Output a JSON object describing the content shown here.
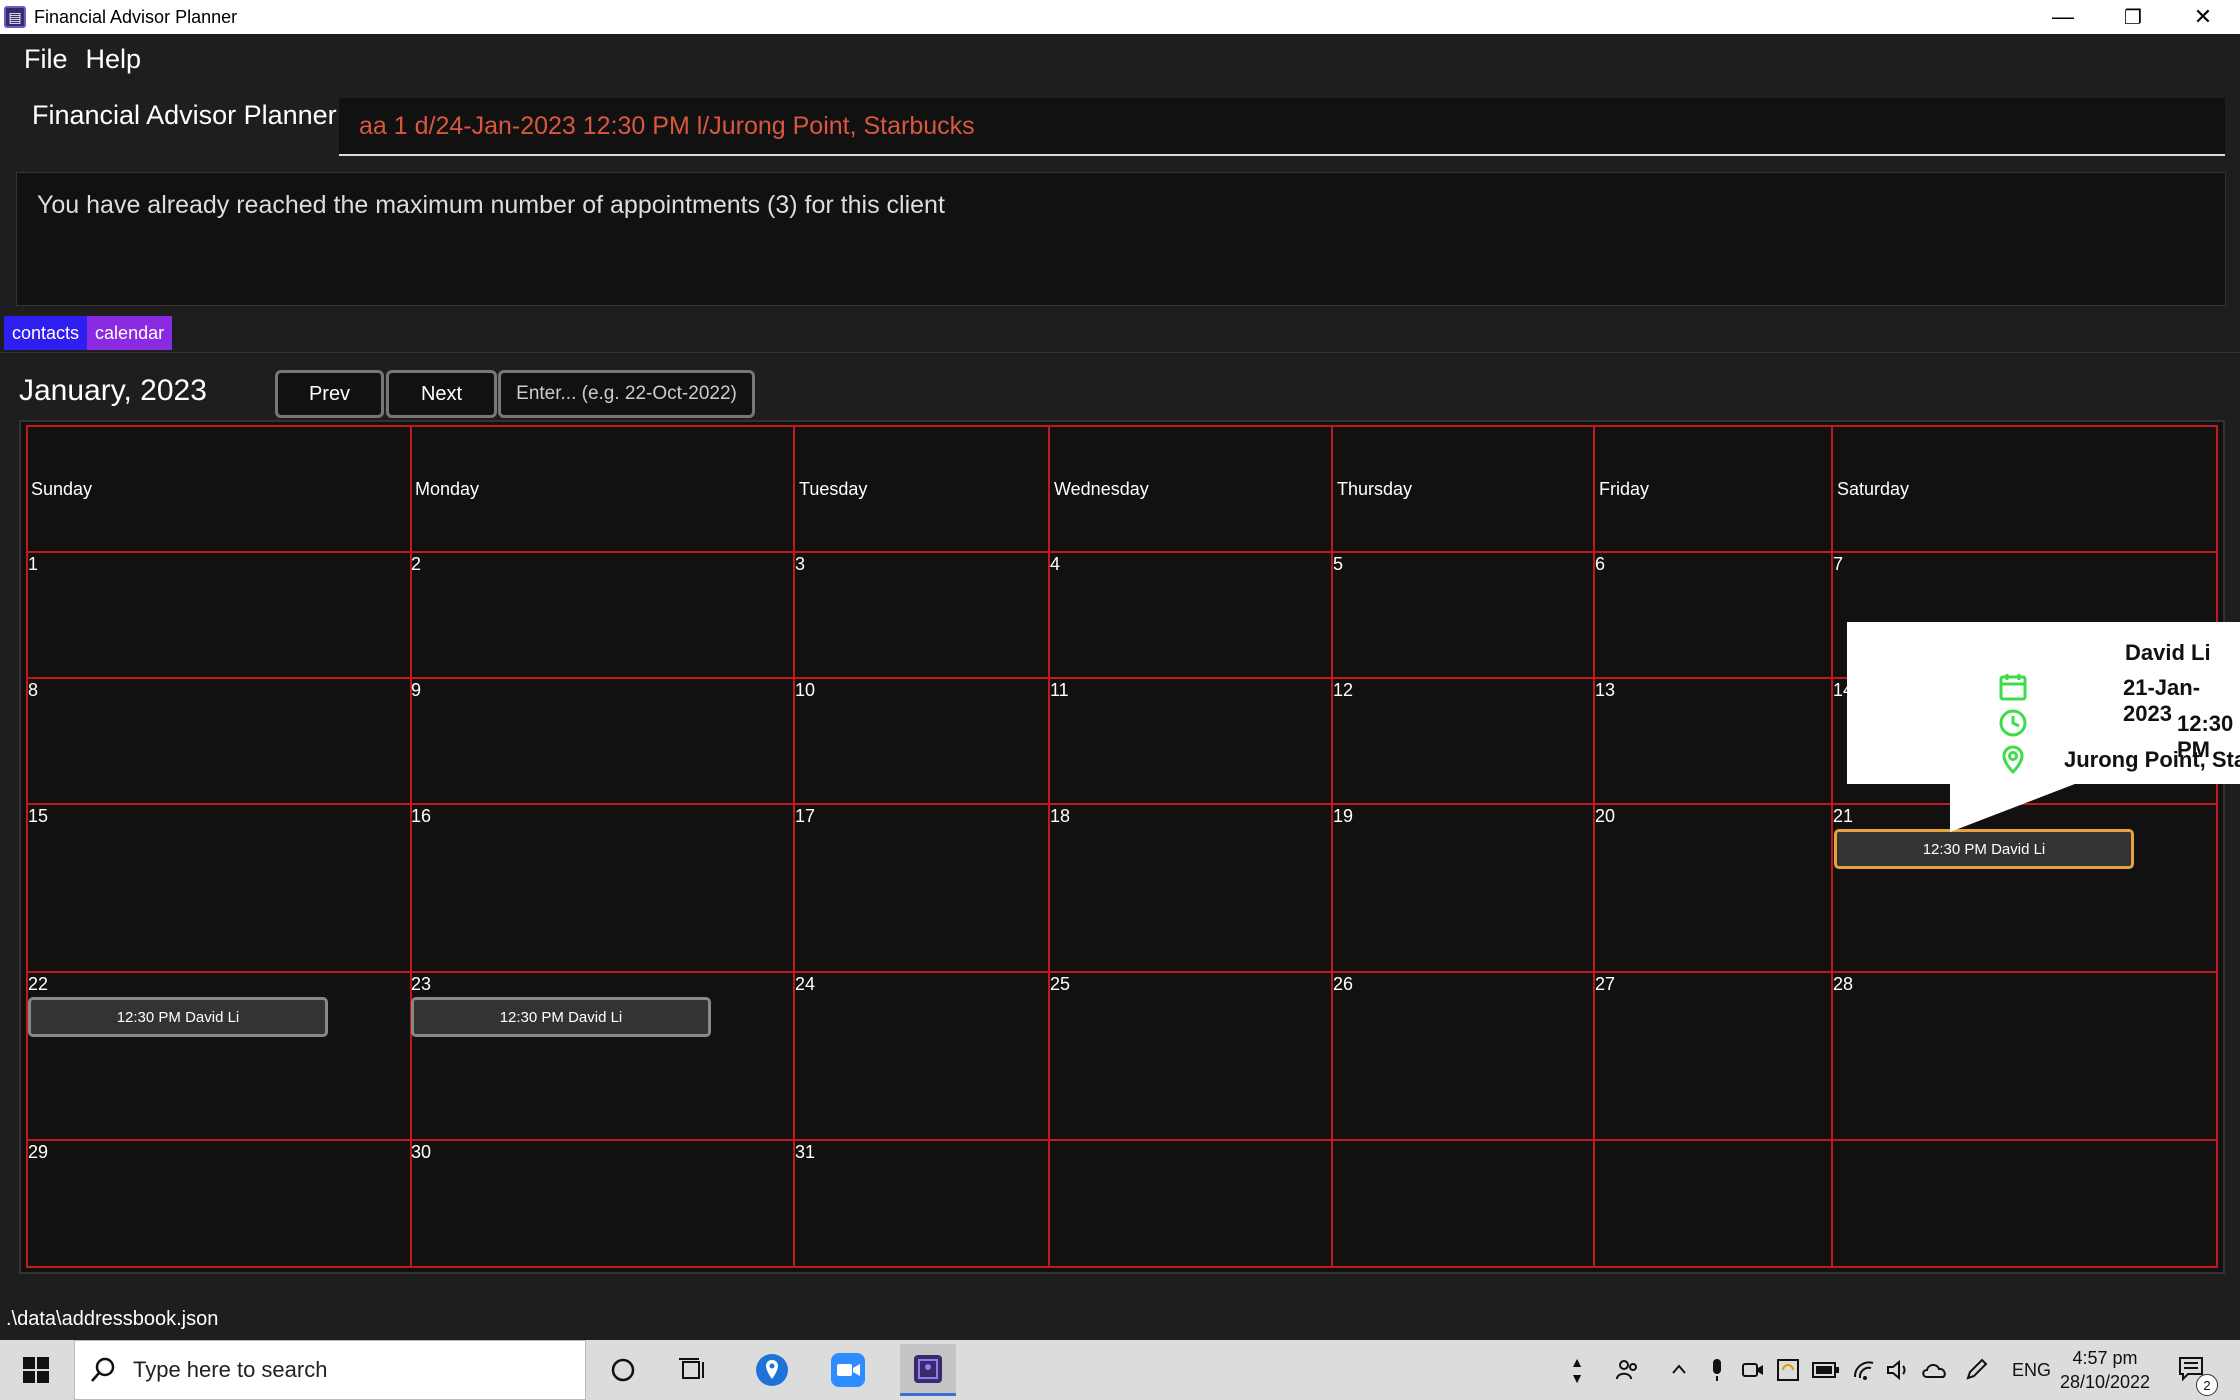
{
  "window": {
    "title": "Financial Advisor Planner",
    "minimize": "—",
    "restore": "❐",
    "close": "✕"
  },
  "menu": {
    "file": "File",
    "help": "Help"
  },
  "command": {
    "label": "Financial Advisor Planner",
    "value": "aa 1 d/24-Jan-2023 12:30 PM l/Jurong Point, Starbucks"
  },
  "result": {
    "text": "You have already reached the maximum number of appointments (3) for this client"
  },
  "tabs": [
    {
      "label": "contacts"
    },
    {
      "label": "calendar"
    }
  ],
  "calendar": {
    "month_label": "January, 2023",
    "prev_label": "Prev",
    "next_label": "Next",
    "jump_placeholder": "Enter... (e.g. 22-Oct-2022)",
    "days": [
      "Sunday",
      "Monday",
      "Tuesday",
      "Wednesday",
      "Thursday",
      "Friday",
      "Saturday"
    ],
    "dates": [
      "1",
      "2",
      "3",
      "4",
      "5",
      "6",
      "7",
      "8",
      "9",
      "10",
      "11",
      "12",
      "13",
      "14",
      "15",
      "16",
      "17",
      "18",
      "19",
      "20",
      "21",
      "22",
      "23",
      "24",
      "25",
      "26",
      "27",
      "28",
      "29",
      "30",
      "31"
    ],
    "appointments": [
      {
        "date": "21",
        "text": "12:30 PM David Li"
      },
      {
        "date": "22",
        "text": "12:30 PM David Li"
      },
      {
        "date": "23",
        "text": "12:30 PM David Li"
      }
    ]
  },
  "popover": {
    "name": "David Li",
    "date": "21-Jan-2023",
    "time": "12:30 PM",
    "location": "Jurong Point, Star"
  },
  "status": {
    "path": ".\\data\\addressbook.json"
  },
  "taskbar": {
    "search_placeholder": "Type here to search",
    "language": "ENG",
    "time": "4:57 pm",
    "date": "28/10/2022",
    "notification_count": "2"
  },
  "colors": {
    "grid": "#c21a1a",
    "command_text": "#d9573f",
    "contacts_tab": "#2e1ff0",
    "calendar_tab": "#8a2be2",
    "popover_icon": "#3ddc4a",
    "active_appt": "#e6a23c"
  }
}
